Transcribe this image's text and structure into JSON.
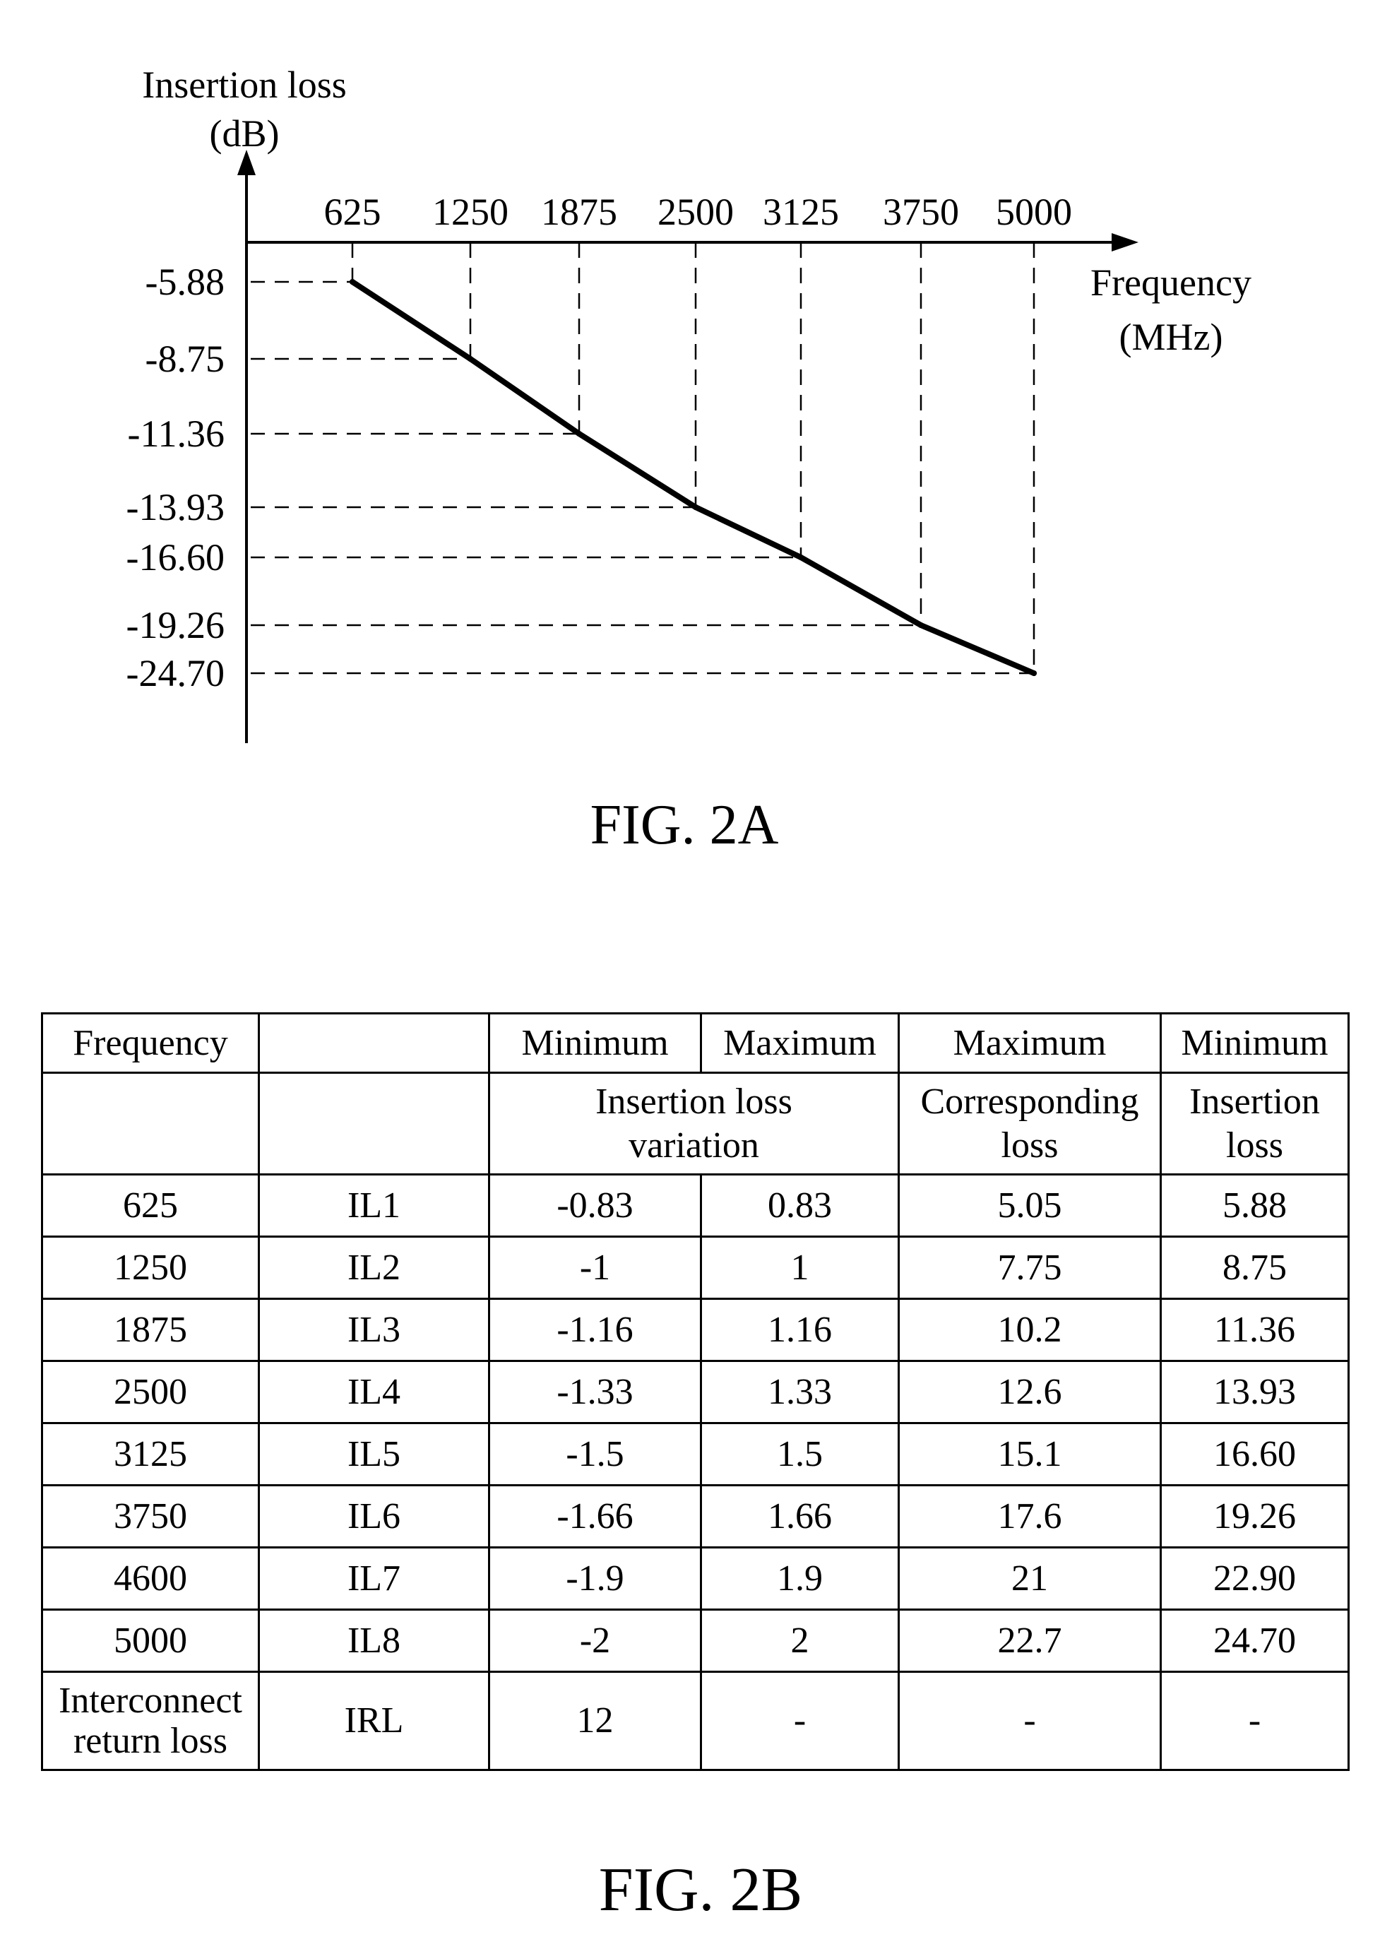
{
  "figures": {
    "fig_2a": {
      "caption": "FIG. 2A"
    },
    "fig_2b": {
      "caption": "FIG. 2B"
    }
  },
  "chart_data": {
    "type": "line",
    "title": "",
    "xlabel": [
      "Frequency",
      "(MHz)"
    ],
    "ylabel": [
      "Insertion loss",
      "(dB)"
    ],
    "x_tick_labels": [
      "625",
      "1250",
      "1875",
      "2500",
      "3125",
      "3750",
      "5000"
    ],
    "y_tick_labels": [
      "-5.88",
      "-8.75",
      "-11.36",
      "-13.93",
      "-16.60",
      "-19.26",
      "-24.70"
    ],
    "x": [
      625,
      1250,
      1875,
      2500,
      3125,
      3750,
      5000
    ],
    "series": [
      {
        "name": "Insertion loss",
        "values": [
          -5.88,
          -8.75,
          -11.36,
          -13.93,
          -16.6,
          -19.26,
          -24.7
        ]
      }
    ],
    "x_axis_position": "top",
    "guide_lines": "dashed projections from each point to both axes",
    "grid": false,
    "legend": "none"
  },
  "table": {
    "header_row_1": [
      "Frequency",
      "",
      "Minimum",
      "Maximum",
      "Maximum",
      "Minimum"
    ],
    "header_row_2": {
      "col1": "",
      "col2": "",
      "insertion_loss_variation": [
        "Insertion loss",
        "variation"
      ],
      "corresponding_loss": [
        "Corresponding",
        "loss"
      ],
      "insertion_loss": [
        "Insertion",
        "loss"
      ]
    },
    "rows": [
      {
        "frequency": "625",
        "name": "IL1",
        "min_variation": "-0.83",
        "max_variation": "0.83",
        "max_corresponding_loss": "5.05",
        "min_insertion_loss": "5.88"
      },
      {
        "frequency": "1250",
        "name": "IL2",
        "min_variation": "-1",
        "max_variation": "1",
        "max_corresponding_loss": "7.75",
        "min_insertion_loss": "8.75"
      },
      {
        "frequency": "1875",
        "name": "IL3",
        "min_variation": "-1.16",
        "max_variation": "1.16",
        "max_corresponding_loss": "10.2",
        "min_insertion_loss": "11.36"
      },
      {
        "frequency": "2500",
        "name": "IL4",
        "min_variation": "-1.33",
        "max_variation": "1.33",
        "max_corresponding_loss": "12.6",
        "min_insertion_loss": "13.93"
      },
      {
        "frequency": "3125",
        "name": "IL5",
        "min_variation": "-1.5",
        "max_variation": "1.5",
        "max_corresponding_loss": "15.1",
        "min_insertion_loss": "16.60"
      },
      {
        "frequency": "3750",
        "name": "IL6",
        "min_variation": "-1.66",
        "max_variation": "1.66",
        "max_corresponding_loss": "17.6",
        "min_insertion_loss": "19.26"
      },
      {
        "frequency": "4600",
        "name": "IL7",
        "min_variation": "-1.9",
        "max_variation": "1.9",
        "max_corresponding_loss": "21",
        "min_insertion_loss": "22.90"
      },
      {
        "frequency": "5000",
        "name": "IL8",
        "min_variation": "-2",
        "max_variation": "2",
        "max_corresponding_loss": "22.7",
        "min_insertion_loss": "24.70"
      }
    ],
    "irl_row": {
      "frequency": [
        "Interconnect",
        "return loss"
      ],
      "name": "IRL",
      "min_variation": "12",
      "max_variation": "-",
      "max_corresponding_loss": "-",
      "min_insertion_loss": "-"
    }
  }
}
